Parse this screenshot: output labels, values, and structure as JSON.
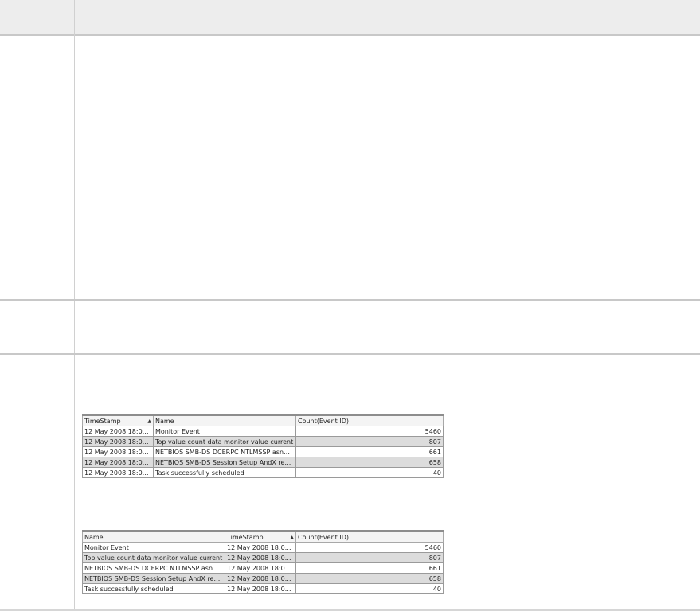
{
  "table1": {
    "columns": [
      {
        "label": "TimeStamp",
        "sorted": true
      },
      {
        "label": "Name",
        "sorted": false
      },
      {
        "label": "Count(Event ID)",
        "sorted": false
      }
    ],
    "rows": [
      {
        "timestamp": "12 May 2008 18:00...",
        "name": "Monitor Event",
        "count": "5460"
      },
      {
        "timestamp": "12 May 2008 18:00...",
        "name": "Top value count data monitor value current",
        "count": "807"
      },
      {
        "timestamp": "12 May 2008 18:00...",
        "name": "NETBIOS SMB-DS DCERPC NTLMSSP asn1 ...",
        "count": "661"
      },
      {
        "timestamp": "12 May 2008 18:00...",
        "name": "NETBIOS SMB-DS Session Setup AndX req...",
        "count": "658"
      },
      {
        "timestamp": "12 May 2008 18:00...",
        "name": "Task successfully scheduled",
        "count": "40"
      }
    ]
  },
  "table2": {
    "columns": [
      {
        "label": "Name",
        "sorted": false
      },
      {
        "label": "TimeStamp",
        "sorted": true
      },
      {
        "label": "Count(Event ID)",
        "sorted": false
      }
    ],
    "rows": [
      {
        "name": "Monitor Event",
        "timestamp": "12 May 2008 18:00...",
        "count": "5460"
      },
      {
        "name": "Top value count data monitor value current",
        "timestamp": "12 May 2008 18:00...",
        "count": "807"
      },
      {
        "name": "NETBIOS SMB-DS DCERPC NTLMSSP asn1 ...",
        "timestamp": "12 May 2008 18:00...",
        "count": "661"
      },
      {
        "name": "NETBIOS SMB-DS Session Setup AndX req...",
        "timestamp": "12 May 2008 18:00...",
        "count": "658"
      },
      {
        "name": "Task successfully scheduled",
        "timestamp": "12 May 2008 18:00...",
        "count": "40"
      }
    ]
  },
  "sort_indicator": "▲"
}
